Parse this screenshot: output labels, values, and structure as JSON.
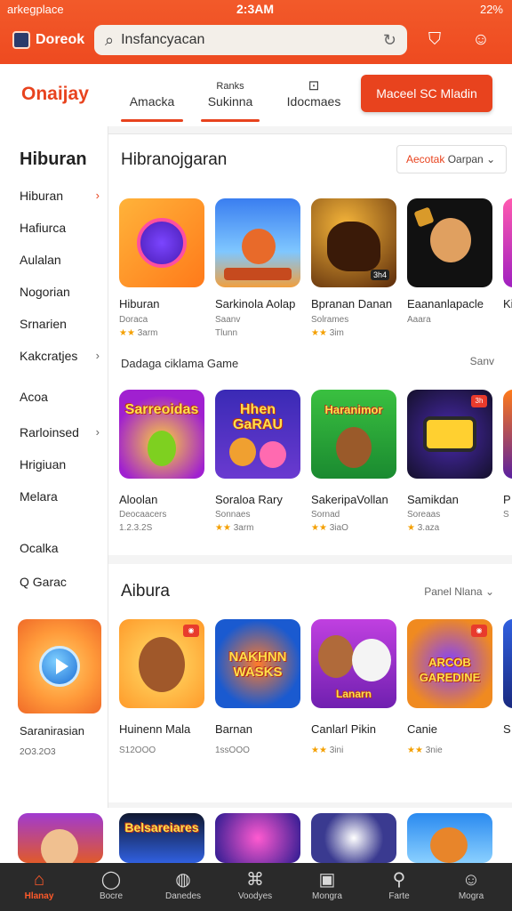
{
  "status": {
    "left": "arkegplace",
    "time": "2:3AM",
    "right": "22%"
  },
  "header": {
    "brand": "Doreok",
    "search_value": "Insfancyacan"
  },
  "nav": {
    "title": "Onaijay",
    "tabs": [
      {
        "label": "Amacka",
        "sub": ""
      },
      {
        "label": "Sukinna",
        "sub": "Ranks"
      },
      {
        "label": "Idocmaes",
        "sub": ""
      }
    ],
    "cta": "Maceel SC Mladin"
  },
  "sidebar": {
    "title": "Hiburan",
    "items": [
      "Hiburan",
      "Hafiurca",
      "Aulalan",
      "Nogorian",
      "Srnarien",
      "Kakcratjes",
      "Acoa",
      "Rarloinsed",
      "Hrigiuan",
      "Melara",
      "Ocalka",
      "Q Garac"
    ],
    "card": {
      "name": "Saranirasian",
      "meta": "2O3.2O3"
    }
  },
  "section1": {
    "title": "Hibranojgaran",
    "sort_accent": "Aecotak",
    "sort_label": "Oarpan",
    "row1": [
      {
        "name": "Hiburan",
        "cat": "Doraca",
        "rating": "3arm"
      },
      {
        "name": "Sarkinola Aolap",
        "cat": "Saanv",
        "rating": "Tlunn"
      },
      {
        "name": "Bpranan Danan",
        "cat": "Solrames",
        "rating": "3im"
      },
      {
        "name": "Eaananlapacle",
        "cat": "Aaara",
        "rating": ""
      },
      {
        "name": "Ki",
        "cat": "",
        "rating": ""
      }
    ],
    "subhead": "Dadaga ciklama Game",
    "subhead_right": "Sanv",
    "row2": [
      {
        "name": "Aloolan",
        "cat": "Deocaacers",
        "rating": "1.2.3.2S",
        "word": "Sarreoidas"
      },
      {
        "name": "Soraloa Rary",
        "cat": "Sonnaes",
        "rating": "3arm",
        "word": "Hhen GaRAU"
      },
      {
        "name": "SakeripaVollan",
        "cat": "Sornad",
        "rating": "3iaO",
        "word": "Haranimor"
      },
      {
        "name": "Samikdan",
        "cat": "Soreaas",
        "rating": "3.aza",
        "word": ""
      },
      {
        "name": "P",
        "cat": "S",
        "rating": "",
        "word": ""
      }
    ],
    "badges": {
      "r1t4": "3h4",
      "r2t4": "3h"
    }
  },
  "section2": {
    "title": "Aibura",
    "sort_label": "Panel Nlana",
    "row": [
      {
        "name": "Huinenn Mala",
        "rating": "S12OOO",
        "word": ""
      },
      {
        "name": "Barnan",
        "rating": "1ssOOO",
        "word": "NAKHNN WASKS"
      },
      {
        "name": "Canlarl Pikin",
        "rating": "3ini",
        "word": "Lanarn"
      },
      {
        "name": "Canie",
        "rating": "3nie",
        "word": "ARCOB GAREDINE"
      },
      {
        "name": "S",
        "rating": "",
        "word": ""
      }
    ]
  },
  "strip": {
    "word": "Belsareiares"
  },
  "bottom_nav": [
    {
      "label": "Hlanay",
      "icon": "home-icon"
    },
    {
      "label": "Bocre",
      "icon": "search-icon"
    },
    {
      "label": "Danedes",
      "icon": "chat-icon"
    },
    {
      "label": "Voodyes",
      "icon": "gift-icon"
    },
    {
      "label": "Mongra",
      "icon": "box-icon"
    },
    {
      "label": "Farte",
      "icon": "bell-search-icon"
    },
    {
      "label": "Mogra",
      "icon": "user-icon"
    }
  ],
  "colors": {
    "accent": "#e8431e",
    "bottom_bar": "#2a2a2a"
  }
}
